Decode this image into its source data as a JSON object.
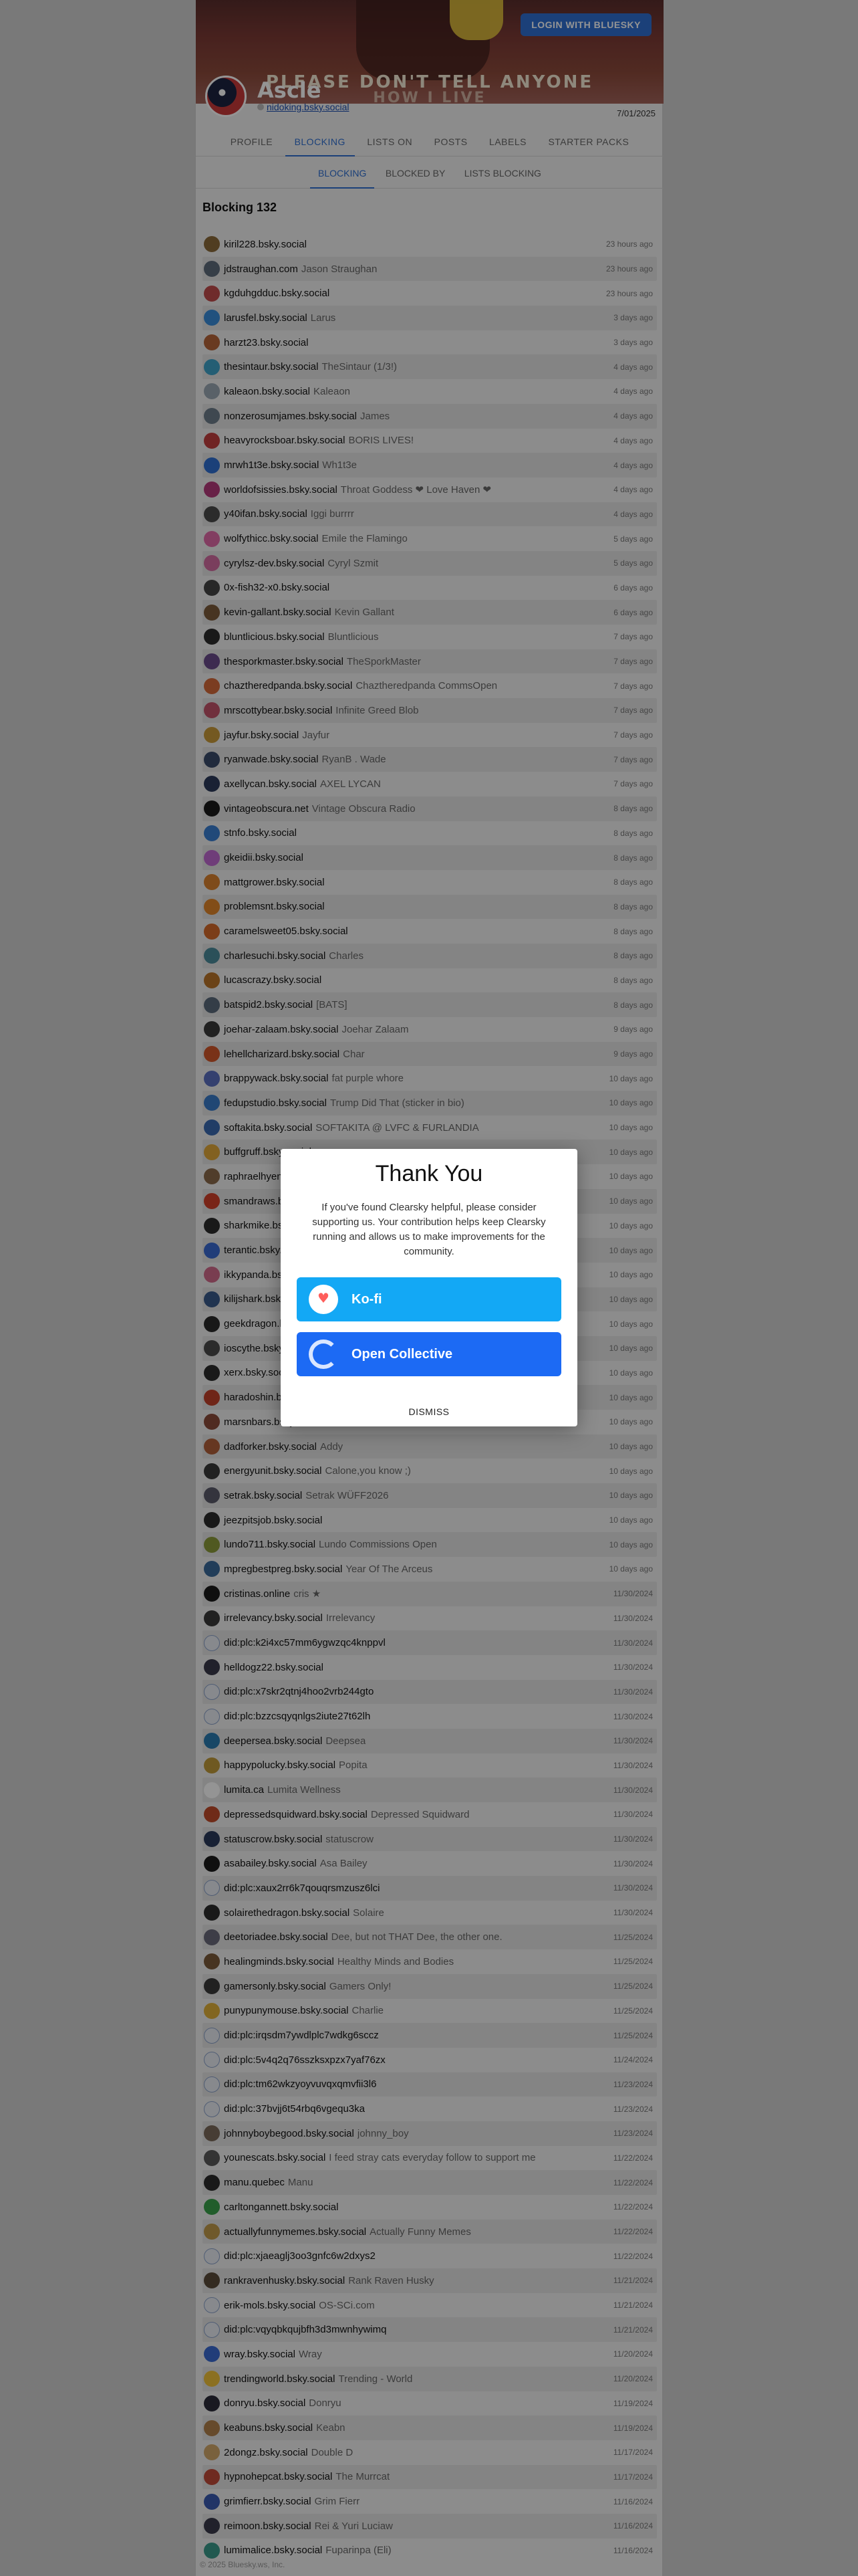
{
  "banner": {
    "caption_line1": "PLEASE DON'T TELL ANYONE",
    "caption_line2": "HOW I LIVE"
  },
  "header": {
    "login_label": "LOGIN WITH BLUESKY"
  },
  "profile": {
    "name": "Ascle",
    "handle": "nidoking.bsky.social",
    "joined": "7/01/2025"
  },
  "tabs": [
    "PROFILE",
    "BLOCKING",
    "LISTS ON",
    "POSTS",
    "LABELS",
    "STARTER PACKS"
  ],
  "subtabs": [
    "BLOCKING",
    "BLOCKED BY",
    "LISTS BLOCKING"
  ],
  "list": {
    "title": "Blocking 132"
  },
  "rows": [
    {
      "handle": "kiril228.bsky.social",
      "name": "",
      "time": "23 hours ago",
      "color": "#8a6a3a"
    },
    {
      "handle": "jdstraughan.com",
      "name": "Jason Straughan",
      "time": "23 hours ago",
      "color": "#5d6b7a"
    },
    {
      "handle": "kgduhgdduc.bsky.social",
      "name": "",
      "time": "23 hours ago",
      "color": "#c04a4a"
    },
    {
      "handle": "larusfel.bsky.social",
      "name": "Larus",
      "time": "3 days ago",
      "color": "#3a8cd9"
    },
    {
      "handle": "harzt23.bsky.social",
      "name": "",
      "time": "3 days ago",
      "color": "#b5643a"
    },
    {
      "handle": "thesintaur.bsky.social",
      "name": "TheSintaur (1/3!)",
      "time": "4 days ago",
      "color": "#3fa3c9"
    },
    {
      "handle": "kaleaon.bsky.social",
      "name": "Kaleaon",
      "time": "4 days ago",
      "color": "#9aa7b4"
    },
    {
      "handle": "nonzerosumjames.bsky.social",
      "name": "James",
      "time": "4 days ago",
      "color": "#6d7c8b"
    },
    {
      "handle": "heavyrocksboar.bsky.social",
      "name": "BORIS LIVES!",
      "time": "4 days ago",
      "color": "#c23f3f"
    },
    {
      "handle": "mrwh1t3e.bsky.social",
      "name": "Wh1t3e",
      "time": "4 days ago",
      "color": "#2f6fd1"
    },
    {
      "handle": "worldofsissies.bsky.social",
      "name": "Throat Goddess ❤ Love Haven ❤",
      "time": "4 days ago",
      "color": "#b33a7a"
    },
    {
      "handle": "y40ifan.bsky.social",
      "name": "Iggi burrrr",
      "time": "4 days ago",
      "color": "#4a4a4a"
    },
    {
      "handle": "wolfythicc.bsky.social",
      "name": "Emile the Flamingo",
      "time": "5 days ago",
      "color": "#e06aa8"
    },
    {
      "handle": "cyrylsz-dev.bsky.social",
      "name": "Cyryl Szmit",
      "time": "5 days ago",
      "color": "#d26ba0"
    },
    {
      "handle": "0x-fish32-x0.bsky.social",
      "name": "",
      "time": "6 days ago",
      "color": "#444"
    },
    {
      "handle": "kevin-gallant.bsky.social",
      "name": "Kevin Gallant",
      "time": "6 days ago",
      "color": "#7a5a3a"
    },
    {
      "handle": "bluntlicious.bsky.social",
      "name": "Bluntlicious",
      "time": "7 days ago",
      "color": "#2b2b2b"
    },
    {
      "handle": "thesporkmaster.bsky.social",
      "name": "TheSporkMaster",
      "time": "7 days ago",
      "color": "#6a4a8a"
    },
    {
      "handle": "chaztheredpanda.bsky.social",
      "name": "Chaztheredpanda CommsOpen",
      "time": "7 days ago",
      "color": "#d56a3a"
    },
    {
      "handle": "mrscottybear.bsky.social",
      "name": "Infinite Greed Blob",
      "time": "7 days ago",
      "color": "#c2536a"
    },
    {
      "handle": "jayfur.bsky.social",
      "name": "Jayfur",
      "time": "7 days ago",
      "color": "#c89a3a"
    },
    {
      "handle": "ryanwade.bsky.social",
      "name": "RyanB . Wade",
      "time": "7 days ago",
      "color": "#3a4a6a"
    },
    {
      "handle": "axellycan.bsky.social",
      "name": "AXEL LYCAN",
      "time": "7 days ago",
      "color": "#2b3a5a"
    },
    {
      "handle": "vintageobscura.net",
      "name": "Vintage Obscura Radio",
      "time": "8 days ago",
      "color": "#1a1a1a"
    },
    {
      "handle": "stnfo.bsky.social",
      "name": "",
      "time": "8 days ago",
      "color": "#3a7fd1"
    },
    {
      "handle": "gkeidii.bsky.social",
      "name": "",
      "time": "8 days ago",
      "color": "#c06ad0"
    },
    {
      "handle": "mattgrower.bsky.social",
      "name": "",
      "time": "8 days ago",
      "color": "#d9812f"
    },
    {
      "handle": "problemsnt.bsky.social",
      "name": "",
      "time": "8 days ago",
      "color": "#e0862a"
    },
    {
      "handle": "caramelsweet05.bsky.social",
      "name": "",
      "time": "8 days ago",
      "color": "#d46a2a"
    },
    {
      "handle": "charlesuchi.bsky.social",
      "name": "Charles",
      "time": "8 days ago",
      "color": "#4a8a9a"
    },
    {
      "handle": "lucascrazy.bsky.social",
      "name": "",
      "time": "8 days ago",
      "color": "#b8742a"
    },
    {
      "handle": "batspid2.bsky.social",
      "name": "[BATS]",
      "time": "8 days ago",
      "color": "#5a6a7a"
    },
    {
      "handle": "joehar-zalaam.bsky.social",
      "name": "Joehar Zalaam",
      "time": "9 days ago",
      "color": "#3a3a3a"
    },
    {
      "handle": "lehellcharizard.bsky.social",
      "name": "Char",
      "time": "9 days ago",
      "color": "#d0562a"
    },
    {
      "handle": "brappywack.bsky.social",
      "name": "fat purple whore",
      "time": "10 days ago",
      "color": "#5a6fc0"
    },
    {
      "handle": "fedupstudio.bsky.social",
      "name": "Trump Did That (sticker in bio)",
      "time": "10 days ago",
      "color": "#3a7ac9"
    },
    {
      "handle": "softakita.bsky.social",
      "name": "SOFTAKITA @ LVFC & FURLANDIA",
      "time": "10 days ago",
      "color": "#3a6ab0"
    },
    {
      "handle": "buffgruff.bsky.social",
      "name": "",
      "time": "10 days ago",
      "color": "#e0a83a"
    },
    {
      "handle": "raphraelhyena.bsky.social",
      "name": "",
      "time": "10 days ago",
      "color": "#8a6a4a"
    },
    {
      "handle": "smandraws.bsky.social",
      "name": "",
      "time": "10 days ago",
      "color": "#d0402a"
    },
    {
      "handle": "sharkmike.bsky.social",
      "name": "",
      "time": "10 days ago",
      "color": "#2b2b2b"
    },
    {
      "handle": "terantic.bsky.social",
      "name": "",
      "time": "10 days ago",
      "color": "#3a6ad0"
    },
    {
      "handle": "ikkypanda.bsky.social",
      "name": "",
      "time": "10 days ago",
      "color": "#d06a8a"
    },
    {
      "handle": "kilijshark.bsky.social",
      "name": "",
      "time": "10 days ago",
      "color": "#3a5a8a"
    },
    {
      "handle": "geekdragon.bsky.social",
      "name": "",
      "time": "10 days ago",
      "color": "#2a2a2a"
    },
    {
      "handle": "ioscythe.bsky.social",
      "name": "",
      "time": "10 days ago",
      "color": "#4a4a4a"
    },
    {
      "handle": "xerx.bsky.social",
      "name": "",
      "time": "10 days ago",
      "color": "#2b2b2b"
    },
    {
      "handle": "haradoshin.bsky.social",
      "name": "",
      "time": "10 days ago",
      "color": "#c0402a"
    },
    {
      "handle": "marsnbars.bsky.social",
      "name": "",
      "time": "10 days ago",
      "color": "#8a4a3a"
    },
    {
      "handle": "dadforker.bsky.social",
      "name": "Addy",
      "time": "10 days ago",
      "color": "#b0603a"
    },
    {
      "handle": "energyunit.bsky.social",
      "name": "Calone,you know ;)",
      "time": "10 days ago",
      "color": "#3a3a3a"
    },
    {
      "handle": "setrak.bsky.social",
      "name": "Setrak WÜFF2026",
      "time": "10 days ago",
      "color": "#5a5a6a"
    },
    {
      "handle": "jeezpitsjob.bsky.social",
      "name": "",
      "time": "10 days ago",
      "color": "#2b2b2b"
    },
    {
      "handle": "lundo711.bsky.social",
      "name": "Lundo Commissions Open",
      "time": "10 days ago",
      "color": "#8a9a3a"
    },
    {
      "handle": "mpregbestpreg.bsky.social",
      "name": "Year Of The Arceus",
      "time": "10 days ago",
      "color": "#3a6a9a"
    },
    {
      "handle": "cristinas.online",
      "name": "cris ★",
      "time": "11/30/2024",
      "color": "#1a1a1a"
    },
    {
      "handle": "irrelevancy.bsky.social",
      "name": "Irrelevancy",
      "time": "11/30/2024",
      "color": "#3a3a3a"
    },
    {
      "handle": "did:plc:k2i4xc57mm6ygwzqc4knppvl",
      "name": "",
      "time": "11/30/2024",
      "color": "did"
    },
    {
      "handle": "helldogz22.bsky.social",
      "name": "",
      "time": "11/30/2024",
      "color": "#3a3a4a"
    },
    {
      "handle": "did:plc:x7skr2qtnj4hoo2vrb244gto",
      "name": "",
      "time": "11/30/2024",
      "color": "did"
    },
    {
      "handle": "did:plc:bzzcsqyqnlgs2iute27t62lh",
      "name": "",
      "time": "11/30/2024",
      "color": "did"
    },
    {
      "handle": "deepersea.bsky.social",
      "name": "Deepsea",
      "time": "11/30/2024",
      "color": "#2a7ab0"
    },
    {
      "handle": "happypolucky.bsky.social",
      "name": "Popita",
      "time": "11/30/2024",
      "color": "#c09a3a"
    },
    {
      "handle": "lumita.ca",
      "name": "Lumita Wellness",
      "time": "11/30/2024",
      "color": "#ffffff"
    },
    {
      "handle": "depressedsquidward.bsky.social",
      "name": "Depressed Squidward",
      "time": "11/30/2024",
      "color": "#c04a2a"
    },
    {
      "handle": "statuscrow.bsky.social",
      "name": "statuscrow",
      "time": "11/30/2024",
      "color": "#2a3a5a"
    },
    {
      "handle": "asabailey.bsky.social",
      "name": "Asa Bailey",
      "time": "11/30/2024",
      "color": "#1a1a1a"
    },
    {
      "handle": "did:plc:xaux2rr6k7qouqrsmzusz6lci",
      "name": "",
      "time": "11/30/2024",
      "color": "did"
    },
    {
      "handle": "solairethedragon.bsky.social",
      "name": "Solaire",
      "time": "11/30/2024",
      "color": "#2b2b2b"
    },
    {
      "handle": "deetoriadee.bsky.social",
      "name": "Dee, but not THAT Dee, the other one.",
      "time": "11/25/2024",
      "color": "#6a6a7a"
    },
    {
      "handle": "healingminds.bsky.social",
      "name": "Healthy Minds and Bodies",
      "time": "11/25/2024",
      "color": "#7a5a3a"
    },
    {
      "handle": "gamersonly.bsky.social",
      "name": "Gamers Only!",
      "time": "11/25/2024",
      "color": "#3a3a3a"
    },
    {
      "handle": "punypunymouse.bsky.social",
      "name": "Charlie",
      "time": "11/25/2024",
      "color": "#e0b03a"
    },
    {
      "handle": "did:plc:irqsdm7ywdlplc7wdkg6sccz",
      "name": "",
      "time": "11/25/2024",
      "color": "did"
    },
    {
      "handle": "did:plc:5v4q2q76sszksxpzx7yaf76zx",
      "name": "",
      "time": "11/24/2024",
      "color": "did"
    },
    {
      "handle": "did:plc:tm62wkzyoyvuvqxqmvfii3l6",
      "name": "",
      "time": "11/23/2024",
      "color": "did"
    },
    {
      "handle": "did:plc:37bvjj6t54rbq6vgequ3ka",
      "name": "",
      "time": "11/23/2024",
      "color": "did"
    },
    {
      "handle": "johnnyboybegood.bsky.social",
      "name": "johnny_boy",
      "time": "11/23/2024",
      "color": "#7a6a5a"
    },
    {
      "handle": "younescats.bsky.social",
      "name": "I feed stray cats everyday follow to support me",
      "time": "11/22/2024",
      "color": "#5a5a5a"
    },
    {
      "handle": "manu.quebec",
      "name": "Manu",
      "time": "11/22/2024",
      "color": "#2b2b2b"
    },
    {
      "handle": "carltongannett.bsky.social",
      "name": "",
      "time": "11/22/2024",
      "color": "#3aa04a"
    },
    {
      "handle": "actuallyfunnymemes.bsky.social",
      "name": "Actually Funny Memes",
      "time": "11/22/2024",
      "color": "#c09a4a"
    },
    {
      "handle": "did:plc:xjaeaglj3oo3gnfc6w2dxys2",
      "name": "",
      "time": "11/22/2024",
      "color": "did"
    },
    {
      "handle": "rankravenhusky.bsky.social",
      "name": "Rank Raven Husky",
      "time": "11/21/2024",
      "color": "#5a4a3a"
    },
    {
      "handle": "erik-mols.bsky.social",
      "name": "OS-SCi.com",
      "time": "11/21/2024",
      "color": "did"
    },
    {
      "handle": "did:plc:vqyqbkqujbfh3d3mwnhywimq",
      "name": "",
      "time": "11/21/2024",
      "color": "did"
    },
    {
      "handle": "wray.bsky.social",
      "name": "Wray",
      "time": "11/20/2024",
      "color": "#3a6ad0"
    },
    {
      "handle": "trendingworld.bsky.social",
      "name": "Trending - World",
      "time": "11/20/2024",
      "color": "#f0c23a"
    },
    {
      "handle": "donryu.bsky.social",
      "name": "Donryu",
      "time": "11/19/2024",
      "color": "#2b2b3a"
    },
    {
      "handle": "keabuns.bsky.social",
      "name": "Keabn",
      "time": "11/19/2024",
      "color": "#b0804a"
    },
    {
      "handle": "2dongz.bsky.social",
      "name": "Double D",
      "time": "11/17/2024",
      "color": "#d0a86a"
    },
    {
      "handle": "hypnohepcat.bsky.social",
      "name": "The Murrcat",
      "time": "11/17/2024",
      "color": "#c04a3a"
    },
    {
      "handle": "grimfierr.bsky.social",
      "name": "Grim Fierr",
      "time": "11/16/2024",
      "color": "#3a5ab0"
    },
    {
      "handle": "reimoon.bsky.social",
      "name": "Rei & Yuri Luciaw",
      "time": "11/16/2024",
      "color": "#3a3a4a"
    },
    {
      "handle": "lumimalice.bsky.social",
      "name": "Fuparinpa (Eli)",
      "time": "11/16/2024",
      "color": "#3a9a8a"
    }
  ],
  "modal": {
    "title": "Thank You",
    "body": "If you've found Clearsky helpful, please consider supporting us. Your contribution helps keep Clearsky running and allows us to make improvements for the community.",
    "kofi_label": "Ko-fi",
    "oc_label": "Open Collective",
    "dismiss_label": "DISMISS"
  },
  "footer": {
    "text": "© 2025 Bluesky.ws, Inc."
  }
}
